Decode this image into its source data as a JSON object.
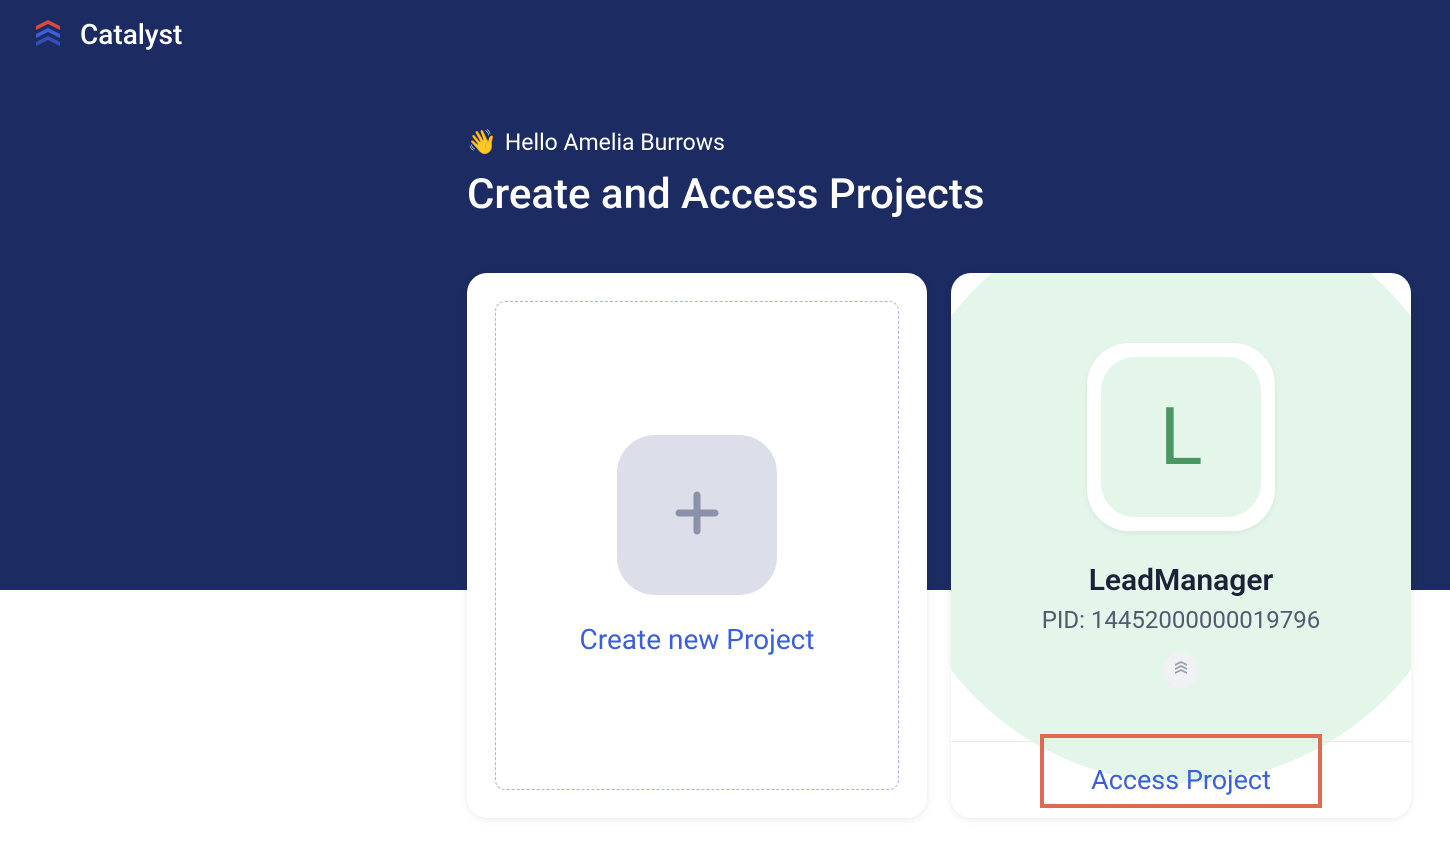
{
  "header": {
    "brand": "Catalyst"
  },
  "greeting": {
    "wave_emoji": "👋",
    "text": "Hello Amelia Burrows"
  },
  "page_title": "Create and Access Projects",
  "create_card": {
    "label": "Create new Project"
  },
  "project_card": {
    "avatar_letter": "L",
    "name": "LeadManager",
    "pid_label": "PID: 14452000000019796",
    "access_label": "Access Project"
  }
}
